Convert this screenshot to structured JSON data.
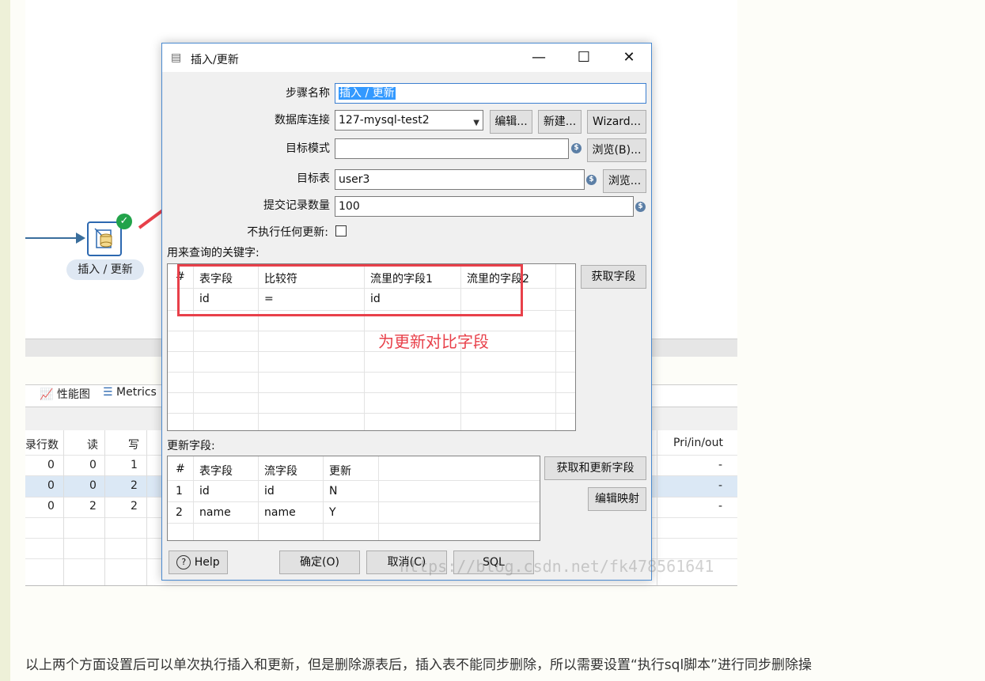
{
  "background": {
    "step_label": "插入 / 更新",
    "tabs": [
      "性能图",
      "Metrics"
    ],
    "table": {
      "headers": [
        "录行数",
        "读",
        "写",
        "Pri/in/out"
      ],
      "rows": [
        [
          "0",
          "0",
          "1",
          "-"
        ],
        [
          "0",
          "0",
          "2",
          "-"
        ],
        [
          "0",
          "2",
          "2",
          "-"
        ]
      ]
    }
  },
  "dialog": {
    "title": "插入/更新",
    "window_controls": {
      "minimize": "—",
      "maximize": "☐",
      "close": "✕"
    },
    "fields": {
      "step_name_label": "步骤名称",
      "step_name_value": "插入 / 更新",
      "db_conn_label": "数据库连接",
      "db_conn_value": "127-mysql-test2",
      "edit_btn": "编辑...",
      "new_btn": "新建...",
      "wizard_btn": "Wizard...",
      "target_schema_label": "目标模式",
      "target_schema_value": "",
      "browse_b_btn": "浏览(B)...",
      "target_table_label": "目标表",
      "target_table_value": "user3",
      "browse_btn": "浏览...",
      "commit_size_label": "提交记录数量",
      "commit_size_value": "100",
      "no_update_label": "不执行任何更新:",
      "no_update_checked": false
    },
    "key_section": {
      "label": "用来查询的关键字:",
      "headers": [
        "#",
        "表字段",
        "比较符",
        "流里的字段1",
        "流里的字段2"
      ],
      "rows": [
        [
          "",
          "id",
          "=",
          "id",
          ""
        ]
      ],
      "get_fields_btn": "获取字段"
    },
    "update_section": {
      "label": "更新字段:",
      "headers": [
        "#",
        "表字段",
        "流字段",
        "更新"
      ],
      "rows": [
        [
          "1",
          "id",
          "id",
          "N"
        ],
        [
          "2",
          "name",
          "name",
          "Y"
        ]
      ],
      "get_update_btn": "获取和更新字段",
      "edit_mapping_btn": "编辑映射"
    },
    "buttons": {
      "help": "Help",
      "ok": "确定(O)",
      "cancel": "取消(C)",
      "sql": "SQL"
    }
  },
  "annotation": {
    "note": "为更新对比字段",
    "color": "#e8404a"
  },
  "watermark": "https://blog.csdn.net/fk478561641",
  "bottom_text": "以上两个方面设置后可以单次执行插入和更新，但是删除源表后，插入表不能同步删除，所以需要设置“执行sql脚本”进行同步删除操"
}
